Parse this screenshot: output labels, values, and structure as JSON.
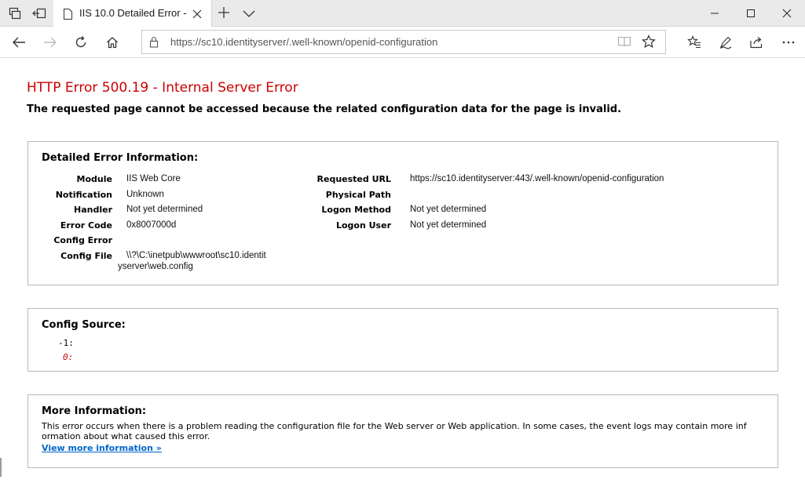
{
  "browser": {
    "tab": {
      "title": "IIS 10.0 Detailed Error -"
    },
    "address": {
      "url": "https://sc10.identityserver/.well-known/openid-configuration"
    }
  },
  "error": {
    "title": "HTTP Error 500.19 - Internal Server Error",
    "subtitle": "The requested page cannot be accessed because the related configuration data for the page is invalid."
  },
  "details": {
    "heading": "Detailed Error Information:",
    "left": [
      {
        "label": "Module",
        "value": "IIS Web Core"
      },
      {
        "label": "Notification",
        "value": "Unknown"
      },
      {
        "label": "Handler",
        "value": "Not yet determined"
      },
      {
        "label": "Error Code",
        "value": "0x8007000d"
      },
      {
        "label": "Config Error",
        "value": ""
      },
      {
        "label": "Config File",
        "value": "\\\\?\\C:\\inetpub\\wwwroot\\sc10.identit",
        "value_cont": "yserver\\web.config"
      }
    ],
    "right": [
      {
        "label": "Requested URL",
        "value": "https://sc10.identityserver:443/.well-known/openid-configuration"
      },
      {
        "label": "Physical Path",
        "value": ""
      },
      {
        "label": "Logon Method",
        "value": "Not yet determined"
      },
      {
        "label": "Logon User",
        "value": "Not yet determined"
      }
    ]
  },
  "config_source": {
    "heading": "Config Source:",
    "lines": [
      "-1:",
      "0:"
    ]
  },
  "more_info": {
    "heading": "More Information:",
    "text": "This error occurs when there is a problem reading the configuration file for the Web server or Web application. In some cases, the event logs may contain more inf ormation about what caused this error.",
    "link": "View more information »"
  },
  "colors": {
    "error_title": "#cc0000",
    "link": "#0066cc",
    "line_zero": "#cc0000",
    "box_border": "#b8b8b8",
    "chrome_bg": "#eaeaea"
  },
  "icons": [
    "tab-actions-icon",
    "set-tabs-aside-icon",
    "page-favicon",
    "close-icon",
    "plus-icon",
    "chevron-down-icon",
    "minimize-icon",
    "maximize-icon",
    "back-arrow-icon",
    "forward-arrow-icon",
    "refresh-icon",
    "home-icon",
    "lock-icon",
    "reading-view-icon",
    "star-icon",
    "favorites-icon",
    "pen-icon",
    "share-icon",
    "more-icon"
  ]
}
